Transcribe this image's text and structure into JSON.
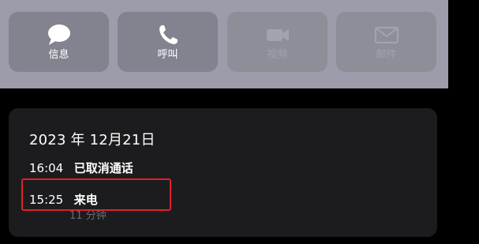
{
  "actions": {
    "message": {
      "label": "信息",
      "icon": "message-bubble-icon",
      "enabled": true
    },
    "call": {
      "label": "呼叫",
      "icon": "phone-icon",
      "enabled": true
    },
    "video": {
      "label": "视频",
      "icon": "video-camera-icon",
      "enabled": false
    },
    "mail": {
      "label": "邮件",
      "icon": "envelope-icon",
      "enabled": false
    }
  },
  "history": {
    "date": "2023 年 12月21日",
    "calls": [
      {
        "time": "16:04",
        "type": "已取消通话"
      },
      {
        "time": "15:25",
        "type": "来电",
        "duration": "11 分钟"
      }
    ]
  },
  "colors": {
    "panel_bg": "#9c9cab",
    "button_bg": "#83838f",
    "card_bg": "#1c1c1e",
    "highlight": "#e0212b"
  }
}
